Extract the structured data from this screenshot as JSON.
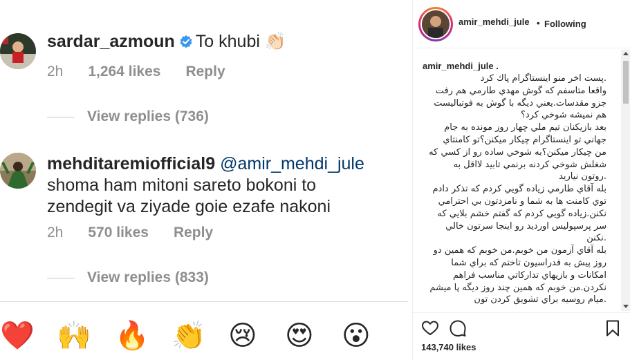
{
  "comments": [
    {
      "username": "sardar_azmoun",
      "verified": true,
      "text": "To khubi 👏🏻",
      "time": "2h",
      "likes": "1,264 likes",
      "reply_label": "Reply",
      "view_replies": "View replies (736)"
    },
    {
      "username": "mehditaremiofficial9",
      "mention": "@amir_mehdi_jule",
      "text_line1": "shoma ham mitoni sareto bokoni to",
      "text_line2": "zendegit va ziyade goie ezafe nakoni",
      "time": "2h",
      "likes": "570 likes",
      "reply_label": "Reply",
      "view_replies": "View replies (833)"
    }
  ],
  "emoji_bar": [
    "❤️",
    "🙌",
    "🔥",
    "👏",
    "😢",
    "😍",
    "😮"
  ],
  "post": {
    "username": "amir_mehdi_jule",
    "follow_status": "Following",
    "caption_user": "amir_mehdi_jule .",
    "caption_lines": [
      ".پست اخر منو اينستاگرام پاك كرد",
      "واقعا متاسفم كه گوش مهدي طارمي هم رفت",
      "جزو مقدسات.يعني ديگه با گوش به فوتباليست",
      "هم نميشه شوخي كرد؟",
      "بعد بازيكنان تيم ملي چهار روز مونده به جام",
      "جهاني تو اينستاگرام چيكار ميكنن؟تو كامنتاي",
      "من چيكار ميكنن؟به شوخي ساده رو از كسي كه",
      "شغلش شوخي كردنه برنمي تابيد لااقل به",
      ".روتون نياريد",
      "بله آقاي طارمي زياده گويي كردم كه تذكر دادم",
      "توي كامنت ها به شما و نامزدتون بي احترامي",
      "نكنن.زياده گويي كردم كه گفتم خشم بلايي كه",
      "سر پرسپوليس اورديد رو اينجا سرتون خالي",
      ".نكنن",
      "بله آقاي آزمون من خوبم.من خوبم كه همين دو",
      "روز پيش به فدراسيون تاختم كه براي شما",
      "امكانات و بازيهاي تداركاتي مناسب فراهم",
      "نكردن.من خوبم كه همين چند روز ديگه پا ميشم",
      ".ميام روسيه براي تشويق كردن تون"
    ],
    "likes": "143,740 likes"
  },
  "colors": {
    "verified_blue": "#3897f0",
    "mention_blue": "#00376b",
    "muted_text": "#8e8e8e"
  },
  "icons": {
    "like": "heart-icon",
    "comment": "comment-bubble-icon",
    "save": "bookmark-icon"
  }
}
